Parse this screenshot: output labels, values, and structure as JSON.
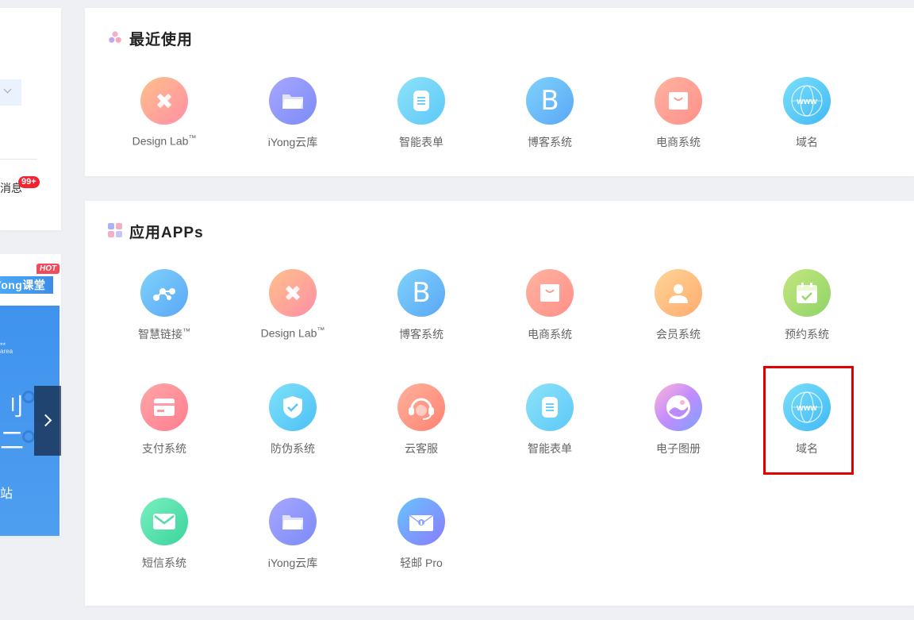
{
  "left_panel": {
    "message_label": "消息",
    "message_badge": "99+"
  },
  "left_banner": {
    "hot_badge": "HOT",
    "course_title": "iYong课堂",
    "tiny_line1": "**",
    "tiny_line2": "area",
    "big_char1": "刂",
    "big_char2": "二",
    "footer_text": "站"
  },
  "recent": {
    "title": "最近使用",
    "items": [
      {
        "label": "Design Lab",
        "tm": "™",
        "icon": "design-lab-icon"
      },
      {
        "label": "iYong云库",
        "tm": "",
        "icon": "cloud-folder-icon"
      },
      {
        "label": "智能表单",
        "tm": "",
        "icon": "form-icon"
      },
      {
        "label": "博客系统",
        "tm": "",
        "icon": "blog-icon"
      },
      {
        "label": "电商系统",
        "tm": "",
        "icon": "shopping-bag-icon"
      },
      {
        "label": "域名",
        "tm": "",
        "icon": "globe-www-icon"
      }
    ]
  },
  "apps": {
    "title": "应用APPs",
    "items": [
      {
        "label": "智慧链接",
        "tm": "™",
        "icon": "smart-link-icon"
      },
      {
        "label": "Design Lab",
        "tm": "™",
        "icon": "design-lab-icon"
      },
      {
        "label": "博客系统",
        "tm": "",
        "icon": "blog-icon"
      },
      {
        "label": "电商系统",
        "tm": "",
        "icon": "shopping-bag-icon"
      },
      {
        "label": "会员系统",
        "tm": "",
        "icon": "member-icon"
      },
      {
        "label": "预约系统",
        "tm": "",
        "icon": "calendar-icon"
      },
      {
        "label": "支付系统",
        "tm": "",
        "icon": "payment-icon"
      },
      {
        "label": "防伪系统",
        "tm": "",
        "icon": "shield-icon"
      },
      {
        "label": "云客服",
        "tm": "",
        "icon": "headset-icon"
      },
      {
        "label": "智能表单",
        "tm": "",
        "icon": "form-icon"
      },
      {
        "label": "电子图册",
        "tm": "",
        "icon": "album-icon"
      },
      {
        "label": "域名",
        "tm": "",
        "icon": "globe-www-icon"
      },
      {
        "label": "短信系统",
        "tm": "",
        "icon": "sms-icon"
      },
      {
        "label": "iYong云库",
        "tm": "",
        "icon": "cloud-folder-icon"
      },
      {
        "label": "轻邮 Pro",
        "tm": "",
        "icon": "mail-icon"
      }
    ]
  },
  "icon_glyphs": {
    "blog_letter": "B",
    "www_text": "www"
  }
}
